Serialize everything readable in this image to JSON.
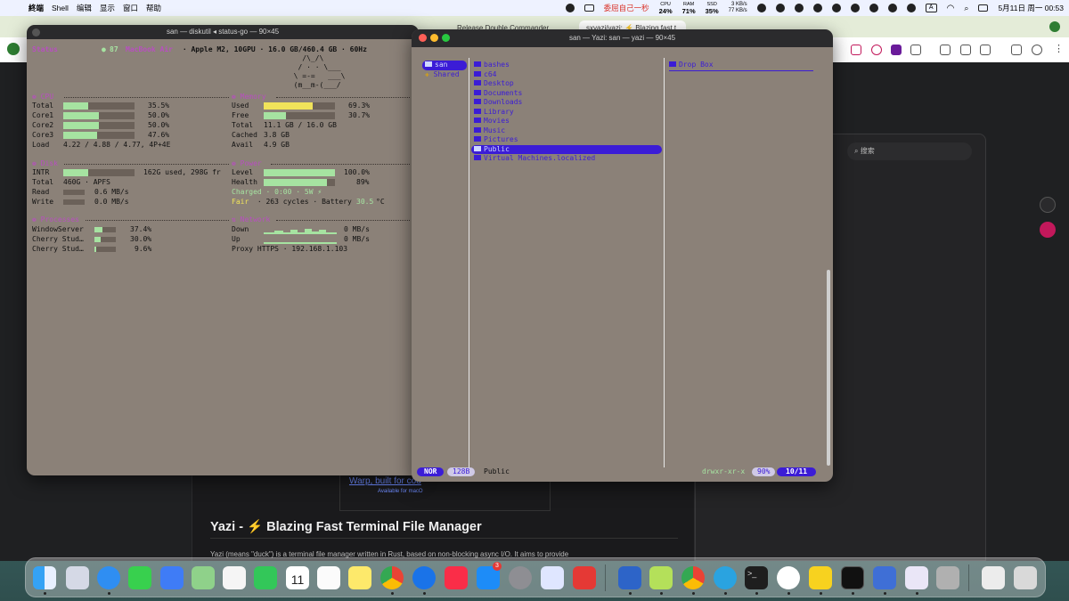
{
  "menubar": {
    "items": [
      "終端",
      "Shell",
      "编辑",
      "显示",
      "窗口",
      "帮助"
    ],
    "right": {
      "tray_text": "委屈自己一秒",
      "cpu_label": "CPU",
      "cpu_value": "24%",
      "ram_label": "RAM",
      "ram_value": "71%",
      "ssd_label": "SSD",
      "ssd_value": "35%",
      "net_up": "3 KB/s",
      "net_down": "77 KB/s",
      "input_method": "A",
      "datetime": "5月11日 周一  00:53"
    }
  },
  "browser": {
    "tabs": [
      "Release Double Commander",
      "sxyazi/yazi: ⚡ Blazing fast t"
    ],
    "side_search_placeholder": "搜索",
    "ad_title": "Warp, built for cod",
    "ad_sub": "Available for macO",
    "heading": "Yazi - ⚡ Blazing Fast Terminal File Manager",
    "body_cut": "Yazi (means \"duck\") is a terminal file manager written in Rust, based on non-blocking async I/O. It aims to provide"
  },
  "status_window": {
    "title": "san — diskutil ◂ status-go — 90×45",
    "status_label": "Status",
    "battery_num": "87",
    "model": "MacBook Air",
    "spec": " · Apple M2, 10GPU · 16.0 GB/460.4 GB · 60Hz",
    "ascii": [
      "    /\\_/\\",
      "   / · · \\___",
      "  \\ =-=   ___\\",
      "  (m__m-(___/"
    ],
    "cpu": {
      "header": "❁ CPU",
      "rows": [
        {
          "label": "Total",
          "value": "35.5%",
          "fill": 0.355
        },
        {
          "label": "Core1",
          "value": "50.0%",
          "fill": 0.5
        },
        {
          "label": "Core2",
          "value": "50.0%",
          "fill": 0.5
        },
        {
          "label": "Core3",
          "value": "47.6%",
          "fill": 0.476
        }
      ],
      "load_label": "Load",
      "load_value": "4.22 / 4.88 / 4.77, 4P+4E"
    },
    "memory": {
      "header": "❁ Memory",
      "used_label": "Used",
      "used_value": "69.3%",
      "used_fill": 0.693,
      "free_label": "Free",
      "free_value": "30.7%",
      "free_fill": 0.307,
      "total_label": "Total",
      "total_value": "11.1 GB / 16.0 GB",
      "cached_label": "Cached",
      "cached_value": "3.8 GB",
      "avail_label": "Avail",
      "avail_value": "4.9 GB"
    },
    "disk": {
      "header": "❁ Disk",
      "intr_label": "INTR",
      "intr_value": "162G used, 298G fr",
      "intr_fill": 0.35,
      "total_label": "Total",
      "total_value": "460G · APFS",
      "read_label": "Read",
      "read_value": "0.6 MB/s",
      "write_label": "Write",
      "write_value": "0.0 MB/s"
    },
    "power": {
      "header": "❁ Power",
      "level_label": "Level",
      "level_value": "100.0%",
      "level_fill": 1.0,
      "health_label": "Health",
      "health_value": "89%",
      "health_fill": 0.89,
      "charged": "Charged · 0:00 · 5W ⚡",
      "fair": "Fair",
      "fair_rest": " · 263 cycles · Battery ",
      "temp": "30.5",
      "temp_unit": "°C"
    },
    "processes": {
      "header": "❁ Processes",
      "rows": [
        {
          "name": "WindowServer",
          "value": "37.4%",
          "fill": 0.374
        },
        {
          "name": "Cherry Stud…",
          "value": "30.0%",
          "fill": 0.3
        },
        {
          "name": "Cherry Stud…",
          "value": "9.6%",
          "fill": 0.096
        }
      ]
    },
    "network": {
      "header": "⇅ Network",
      "down_label": "Down",
      "down_value": "0 MB/s",
      "up_label": "Up",
      "up_value": "0 MB/s",
      "proxy": "Proxy HTTPS · 192.168.1.103"
    }
  },
  "yazi_window": {
    "title": "san — Yazi: san — yazi — 90×45",
    "parent": [
      "san",
      "Shared"
    ],
    "entries": [
      "bashes",
      "c64",
      "Desktop",
      "Documents",
      "Downloads",
      "Library",
      "Movies",
      "Music",
      "Pictures",
      "Public",
      "Virtual Machines.localized"
    ],
    "selected_index": 9,
    "preview": [
      "Drop Box"
    ],
    "status": {
      "mode": "NOR",
      "size": "128B",
      "name": "Public",
      "perms": "drwxr-xr-x",
      "percent": "90%",
      "position": "10/11"
    }
  },
  "colors": {
    "terminal_bg": "#8b8178",
    "accent_purple": "#b84fc0",
    "dir_blue": "#3b1cd6",
    "bar_green": "#a6e3a1",
    "bar_yellow": "#f0e35a"
  },
  "dock": {
    "icons": [
      "finder-icon",
      "launchpad-icon",
      "safari-icon",
      "messages-icon",
      "mail-icon",
      "maps-icon",
      "photos-icon",
      "facetime-icon",
      "calendar-icon",
      "reminders-icon",
      "notes-icon",
      "chrome-icon",
      "chrome-dev-icon",
      "music-icon",
      "app-store-icon",
      "settings-icon",
      "iphone-mirroring-icon",
      "app-icon",
      "app-icon",
      "app-icon",
      "chrome-icon",
      "telegram-icon",
      "terminal-icon",
      "app-icon",
      "app-icon",
      "activity-monitor-icon",
      "app-icon",
      "rocket-icon",
      "input-icon",
      "downloads-icon",
      "trash-icon"
    ],
    "calendar_day": "11",
    "app_store_badge": "3"
  }
}
